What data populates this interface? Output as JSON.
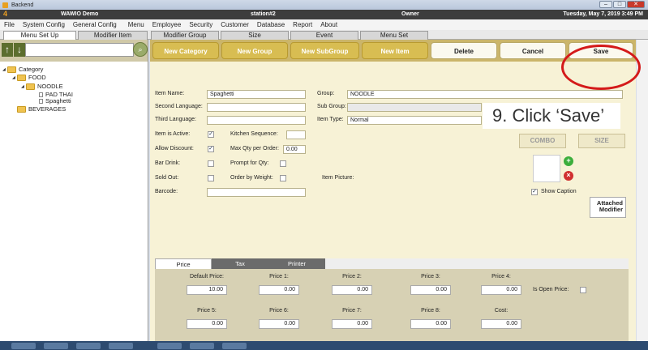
{
  "window": {
    "title": "Backend",
    "controls": [
      "minimize",
      "maximize",
      "close"
    ]
  },
  "appbar": {
    "logo": "4",
    "store": "WAWIO Demo",
    "station": "station#2",
    "user": "Owner",
    "datetime": "Tuesday, May 7, 2019 3:49 PM"
  },
  "menu": [
    "File",
    "System Config",
    "General Config",
    "Menu",
    "Employee",
    "Security",
    "Customer",
    "Database",
    "Report",
    "About"
  ],
  "tabs": [
    "Menu Set Up",
    "Modifier Item",
    "Modifier Group",
    "Size",
    "Event",
    "Menu Set"
  ],
  "tree": [
    {
      "label": "Category"
    },
    {
      "label": "FOOD"
    },
    {
      "label": "NOODLE"
    },
    {
      "label": "PAD THAI"
    },
    {
      "label": "Spaghetti"
    },
    {
      "label": "BEVERAGES"
    }
  ],
  "toolbar": {
    "new_category": "New Category",
    "new_group": "New Group",
    "new_subgroup": "New SubGroup",
    "new_item": "New Item",
    "delete": "Delete",
    "cancel": "Cancel",
    "save": "Save"
  },
  "form": {
    "item_name_label": "Item Name:",
    "item_name": "Spaghetti",
    "second_language_label": "Second Language:",
    "third_language_label": "Third Language:",
    "group_label": "Group:",
    "group": "NOODLE",
    "sub_group_label": "Sub Group:",
    "item_type_label": "Item Type:",
    "item_type": "Normal",
    "item_active_label": "Item is Active:",
    "item_active": true,
    "kitchen_sequence_label": "Kitchen Sequence:",
    "allow_discount_label": "Allow Discount:",
    "allow_discount": true,
    "max_qty_label": "Max Qty per Order:",
    "max_qty": "0.00",
    "bar_drink_label": "Bar Drink:",
    "prompt_qty_label": "Prompt for Qty:",
    "sold_out_label": "Sold Out:",
    "order_weight_label": "Order by Weight:",
    "item_picture_label": "Item Picture:",
    "barcode_label": "Barcode:",
    "combo": "COMBO",
    "size": "SIZE",
    "show_caption_label": "Show Caption",
    "show_caption": true,
    "attached_modifier": "Attached Modifier"
  },
  "callout": "9. Click ‘Save’",
  "price_tabs": [
    "Price",
    "Tax",
    "Printer"
  ],
  "prices": [
    {
      "label": "Default Price:",
      "value": "10.00"
    },
    {
      "label": "Price 1:",
      "value": "0.00"
    },
    {
      "label": "Price 2:",
      "value": "0.00"
    },
    {
      "label": "Price 3:",
      "value": "0.00"
    },
    {
      "label": "Price 4:",
      "value": "0.00"
    },
    {
      "label": "Price 5:",
      "value": "0.00"
    },
    {
      "label": "Price 6:",
      "value": "0.00"
    },
    {
      "label": "Price 7:",
      "value": "0.00"
    },
    {
      "label": "Price 8:",
      "value": "0.00"
    },
    {
      "label": "Cost:",
      "value": "0.00"
    }
  ],
  "open_price_label": "Is Open Price:",
  "colors": {
    "toolbar": "#cbb56a",
    "gold_button": "#d8bd52",
    "panel": "#f7f2d6",
    "highlight": "#d41a1a"
  }
}
